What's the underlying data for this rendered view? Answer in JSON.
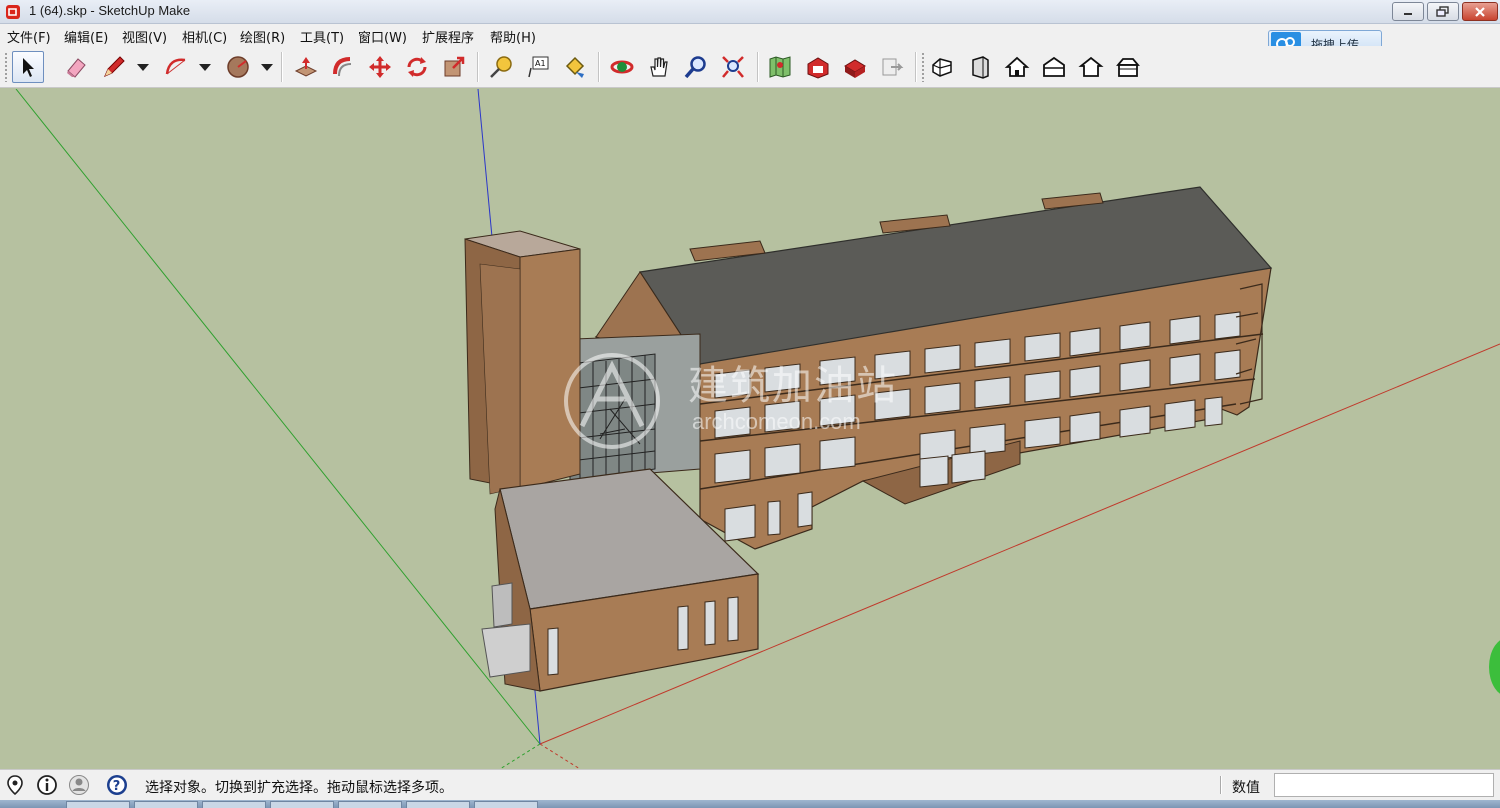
{
  "window": {
    "title": "1 (64).skp - SketchUp Make",
    "controls": [
      "minimize",
      "maximize",
      "close"
    ]
  },
  "menu": [
    {
      "label": "文件(F)"
    },
    {
      "label": "编辑(E)"
    },
    {
      "label": "视图(V)"
    },
    {
      "label": "相机(C)"
    },
    {
      "label": "绘图(R)"
    },
    {
      "label": "工具(T)"
    },
    {
      "label": "窗口(W)"
    },
    {
      "label": "扩展程序"
    },
    {
      "label": "帮助(H)"
    }
  ],
  "upload": {
    "label": "拖拽上传"
  },
  "toolbar": {
    "tools": [
      "select-tool",
      "eraser-tool",
      "pencil-line-tool",
      "arc-tool",
      "shape-tool",
      "push-pull-tool",
      "follow-me-tool",
      "move-tool",
      "rotate-tool",
      "scale-tool",
      "tape-measure-tool",
      "text-tool",
      "paint-bucket-tool",
      "orbit-tool",
      "pan-tool",
      "zoom-tool",
      "zoom-extents-tool",
      "geo-location-tool",
      "3d-warehouse-tool",
      "extension-warehouse-tool",
      "layout-tool",
      "iso-view",
      "front-view",
      "top-view",
      "right-view",
      "back-view",
      "left-view"
    ]
  },
  "viewport": {
    "watermark": {
      "line1": "建筑加油站",
      "line2": "archcomeon.com"
    }
  },
  "status": {
    "text": "选择对象。切换到扩充选择。拖动鼠标选择多项。",
    "measure_label": "数值",
    "measure_value": ""
  },
  "colors": {
    "sky": "#b6c1a0",
    "wall": "#a87c55",
    "roof": "#5b5b57",
    "axis_red": "#c0392b",
    "axis_green": "#2ea02e",
    "axis_blue": "#2b36c9"
  }
}
